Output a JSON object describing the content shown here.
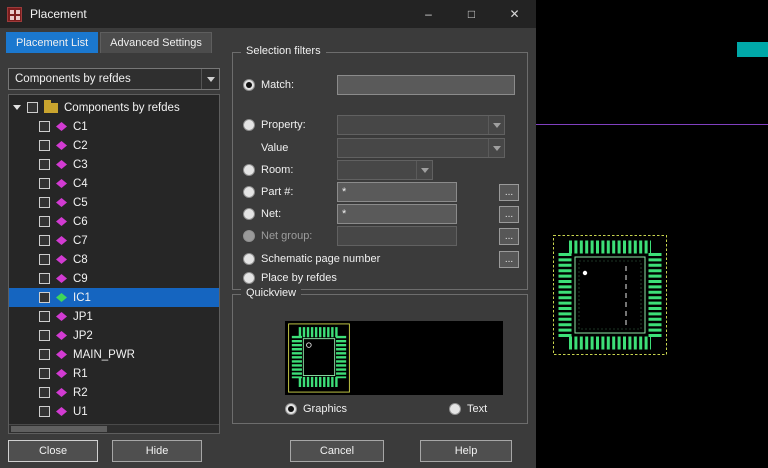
{
  "window": {
    "title": "Placement",
    "minimize_glyph": "–",
    "maximize_glyph": "□",
    "close_glyph": "✕"
  },
  "tabs": {
    "placement_list": "Placement List",
    "advanced_settings": "Advanced Settings"
  },
  "left_panel": {
    "filter_dropdown": "Components by refdes",
    "tree_root_label": "Components by refdes",
    "items": [
      {
        "label": "C1"
      },
      {
        "label": "C2"
      },
      {
        "label": "C3"
      },
      {
        "label": "C4"
      },
      {
        "label": "C5"
      },
      {
        "label": "C6"
      },
      {
        "label": "C7"
      },
      {
        "label": "C8"
      },
      {
        "label": "C9"
      },
      {
        "label": "IC1",
        "selected": true
      },
      {
        "label": "JP1"
      },
      {
        "label": "JP2"
      },
      {
        "label": "MAIN_PWR"
      },
      {
        "label": "R1"
      },
      {
        "label": "R2"
      },
      {
        "label": "U1"
      }
    ]
  },
  "selection_filters": {
    "title": "Selection filters",
    "match_label": "Match:",
    "match_value": "",
    "property_label": "Property:",
    "value_label": "Value",
    "room_label": "Room:",
    "part_label": "Part #:",
    "part_value": "*",
    "net_label": "Net:",
    "net_value": "*",
    "net_group_label": "Net group:",
    "net_group_value": "",
    "schematic_label": "Schematic page number",
    "place_by_refdes_label": "Place by refdes",
    "browse_label": "..."
  },
  "quickview": {
    "title": "Quickview",
    "graphics_label": "Graphics",
    "text_label": "Text"
  },
  "buttons": {
    "close": "Close",
    "hide": "Hide",
    "cancel": "Cancel",
    "help": "Help"
  },
  "colors": {
    "tab_active_blue": "#1b78cf",
    "selection_blue": "#1565c0",
    "component_magenta": "#d23bd2",
    "component_green": "#3fd65a",
    "pad_green": "#3ddf78",
    "outline_yellow": "#c9d44e",
    "canvas_purple": "#8040c0",
    "teal_marker": "#00a8a8"
  }
}
